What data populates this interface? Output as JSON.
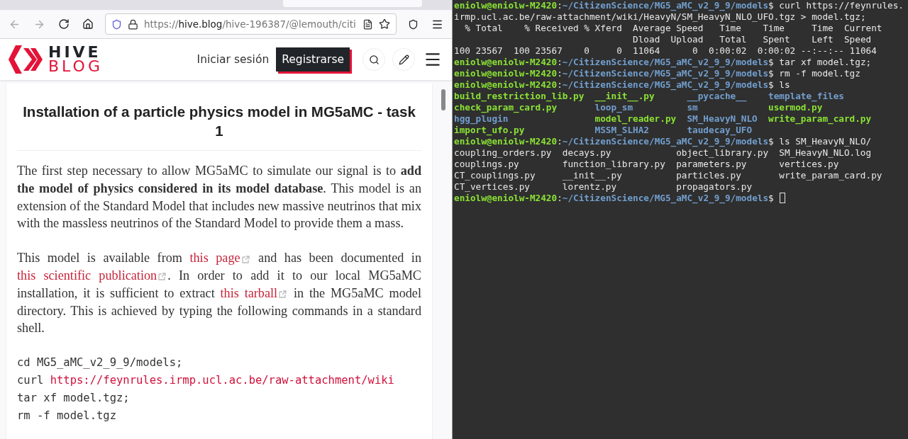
{
  "browser": {
    "url_scheme": "https://",
    "url_host": "hive.blog",
    "url_path": "/hive-196387/@lemouth/citi"
  },
  "site": {
    "logo_top": "HIVE",
    "logo_bottom": "BLOG",
    "login": "Iniciar sesión",
    "signup": "Registrarse"
  },
  "article": {
    "title": "Installation of a particle physics model in MG5aMC - task 1",
    "paragraphs": [
      [
        {
          "kind": "text",
          "text": "The first step necessary to allow MG5aMC to simulate our signal is to **add the model of physics considered in its model database**. This model is an extension of the Standard Model that includes new massive neutrinos that mix with the massless neutrinos of the Standard Model to provide them a mass."
        }
      ],
      [
        {
          "kind": "text",
          "text": "This model is available from "
        },
        {
          "kind": "link",
          "text": "this page"
        },
        {
          "kind": "text",
          "text": " and has been documented in "
        },
        {
          "kind": "link",
          "text": "this scientific publication"
        },
        {
          "kind": "text",
          "text": ". In order to add it to our local MG5aMC installation, it is sufficient to extract "
        },
        {
          "kind": "link",
          "text": "this tarball"
        },
        {
          "kind": "text",
          "text": " in the MG5aMC model directory. This is achieved by typing the following commands in a standard shell."
        }
      ]
    ],
    "code": [
      [
        {
          "kind": "plain",
          "text": "cd MG5_aMC_v2_9_9/models;"
        }
      ],
      [
        {
          "kind": "plain",
          "text": "curl "
        },
        {
          "kind": "link",
          "text": "https://feynrules.irmp.ucl.ac.be/raw-attachment/wiki"
        }
      ],
      [
        {
          "kind": "plain",
          "text": "tar xf model.tgz;"
        }
      ],
      [
        {
          "kind": "plain",
          "text": "rm -f model.tgz"
        }
      ]
    ]
  },
  "terminal": {
    "lines": [
      {
        "kind": "prompt",
        "user": "eniolw@eniolw-M2420",
        "separator": ":",
        "path": "~/CitizenScience/MG5_aMC_v2_9_9/models",
        "command": "$ curl https://feynrules."
      },
      {
        "kind": "text",
        "text": "irmp.ucl.ac.be/raw-attachment/wiki/HeavyN/SM_HeavyN_NLO_UFO.tgz > model.tgz;"
      },
      {
        "kind": "text",
        "text": "  % Total    % Received % Xferd  Average Speed   Time    Time     Time  Current"
      },
      {
        "kind": "text",
        "text": "                                 Dload  Upload   Total   Spent    Left  Speed"
      },
      {
        "kind": "text",
        "text": "100 23567  100 23567    0     0  11064      0  0:00:02  0:00:02 --:--:-- 11064"
      },
      {
        "kind": "prompt",
        "user": "eniolw@eniolw-M2420",
        "separator": ":",
        "path": "~/CitizenScience/MG5_aMC_v2_9_9/models",
        "command": "$ tar xf model.tgz;"
      },
      {
        "kind": "prompt",
        "user": "eniolw@eniolw-M2420",
        "separator": ":",
        "path": "~/CitizenScience/MG5_aMC_v2_9_9/models",
        "command": "$ rm -f model.tgz"
      },
      {
        "kind": "prompt",
        "user": "eniolw@eniolw-M2420",
        "separator": ":",
        "path": "~/CitizenScience/MG5_aMC_v2_9_9/models",
        "command": "$ ls"
      },
      {
        "kind": "listing",
        "rows": [
          [
            {
              "text": "build_restriction_lib.py",
              "kind": "exec"
            },
            {
              "text": "__init__.py",
              "kind": "exec"
            },
            {
              "text": "__pycache__",
              "kind": "dir"
            },
            {
              "text": "template_files",
              "kind": "dir"
            }
          ],
          [
            {
              "text": "check_param_card.py",
              "kind": "exec"
            },
            {
              "text": "loop_sm",
              "kind": "dir"
            },
            {
              "text": "sm",
              "kind": "dir"
            },
            {
              "text": "usermod.py",
              "kind": "exec"
            }
          ],
          [
            {
              "text": "hgg_plugin",
              "kind": "dir"
            },
            {
              "text": "model_reader.py",
              "kind": "exec"
            },
            {
              "text": "SM_HeavyN_NLO",
              "kind": "dir"
            },
            {
              "text": "write_param_card.py",
              "kind": "exec"
            }
          ],
          [
            {
              "text": "import_ufo.py",
              "kind": "exec"
            },
            {
              "text": "MSSM_SLHA2",
              "kind": "dir"
            },
            {
              "text": "taudecay_UFO",
              "kind": "dir"
            }
          ]
        ]
      },
      {
        "kind": "prompt",
        "user": "eniolw@eniolw-M2420",
        "separator": ":",
        "path": "~/CitizenScience/MG5_aMC_v2_9_9/models",
        "command": "$ ls SM_HeavyN_NLO/"
      },
      {
        "kind": "listing",
        "rows": [
          [
            {
              "text": "coupling_orders.py",
              "kind": "file"
            },
            {
              "text": "decays.py",
              "kind": "file"
            },
            {
              "text": "object_library.py",
              "kind": "file"
            },
            {
              "text": "SM_HeavyN_NLO.log",
              "kind": "file"
            }
          ],
          [
            {
              "text": "couplings.py",
              "kind": "file"
            },
            {
              "text": "function_library.py",
              "kind": "file"
            },
            {
              "text": "parameters.py",
              "kind": "file"
            },
            {
              "text": "vertices.py",
              "kind": "file"
            }
          ],
          [
            {
              "text": "CT_couplings.py",
              "kind": "file"
            },
            {
              "text": "__init__.py",
              "kind": "file"
            },
            {
              "text": "particles.py",
              "kind": "file"
            },
            {
              "text": "write_param_card.py",
              "kind": "file"
            }
          ],
          [
            {
              "text": "CT_vertices.py",
              "kind": "file"
            },
            {
              "text": "lorentz.py",
              "kind": "file"
            },
            {
              "text": "propagators.py",
              "kind": "file"
            }
          ]
        ]
      },
      {
        "kind": "input",
        "user": "eniolw@eniolw-M2420",
        "separator": ":",
        "path": "~/CitizenScience/MG5_aMC_v2_9_9/models",
        "command": "$"
      }
    ]
  }
}
